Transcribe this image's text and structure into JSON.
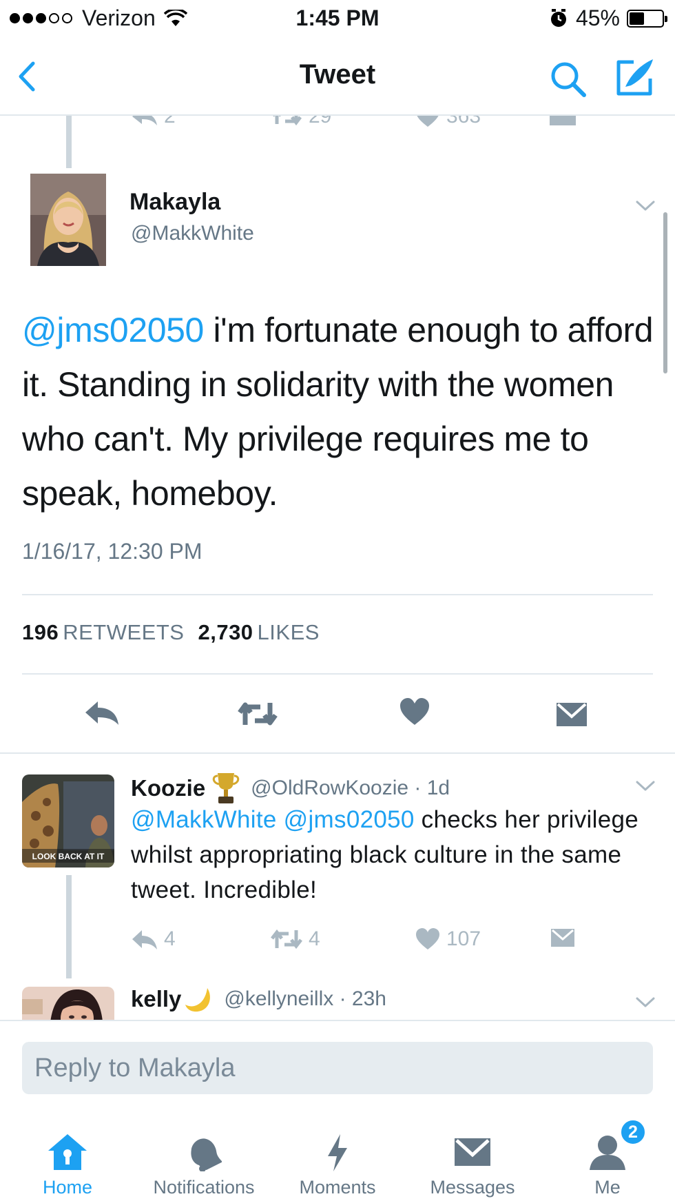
{
  "status_bar": {
    "carrier": "Verizon",
    "time": "1:45 PM",
    "battery": "45%",
    "battery_level": 0.45
  },
  "nav": {
    "title": "Tweet"
  },
  "previous_tweet_actions": {
    "replies": "2",
    "retweets": "29",
    "likes": "363"
  },
  "tweet": {
    "author_name": "Makayla",
    "author_handle": "@MakkWhite",
    "mention": "@jms02050",
    "text": " i'm fortunate enough to afford it. Standing in solidarity with the women who can't. My privilege requires me to speak, homeboy.",
    "date": "1/16/17, 12:30 PM",
    "retweet_count": "196",
    "retweet_label": "RETWEETS",
    "like_count": "2,730",
    "like_label": "LIKES"
  },
  "reply": {
    "author_name": "Koozie",
    "handle_time": "@OldRowKoozie · 1d",
    "avatar_caption": "LOOK BACK AT IT",
    "mention_1": "@MakkWhite",
    "mention_2": "@jms02050",
    "text": " checks her privilege whilst appropriating black culture in the same tweet. Incredible!",
    "replies": "4",
    "retweets": "4",
    "likes": "107"
  },
  "next_reply": {
    "author_name": "kelly",
    "handle_time": "@kellyneillx · 23h"
  },
  "composer": {
    "placeholder": "Reply to Makayla"
  },
  "tabs": [
    {
      "label": "Home",
      "icon": "home-icon"
    },
    {
      "label": "Notifications",
      "icon": "bell-icon"
    },
    {
      "label": "Moments",
      "icon": "lightning-icon"
    },
    {
      "label": "Messages",
      "icon": "envelope-icon"
    },
    {
      "label": "Me",
      "icon": "person-icon",
      "badge": "2"
    }
  ],
  "colors": {
    "accent": "#1da1f2",
    "secondary_text": "#657786",
    "action_gray": "#aab8c2",
    "icon_slate": "#657786"
  }
}
